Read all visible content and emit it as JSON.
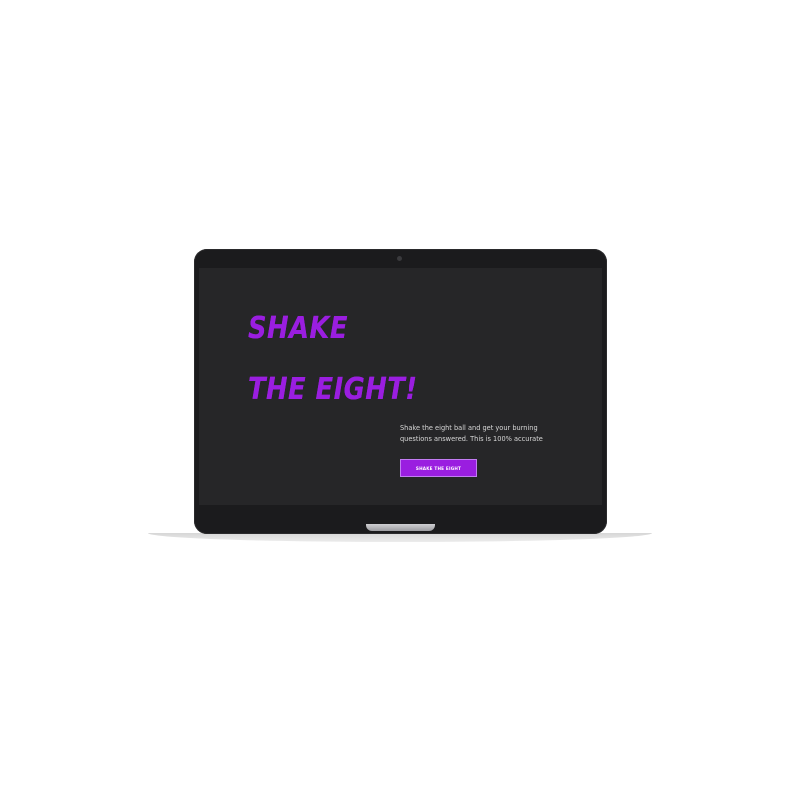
{
  "hero": {
    "line1": "SHAKE",
    "line2": "THE EIGHT!"
  },
  "description": "Shake the eight ball and get your burning questions answered. This is 100% accurate",
  "cta": {
    "label": "SHAKE THE EIGHT"
  },
  "colors": {
    "accent": "#9a1ee0",
    "screen_background": "#262628",
    "bezel": "#1b1b1d",
    "page_background": "#ffffff"
  }
}
